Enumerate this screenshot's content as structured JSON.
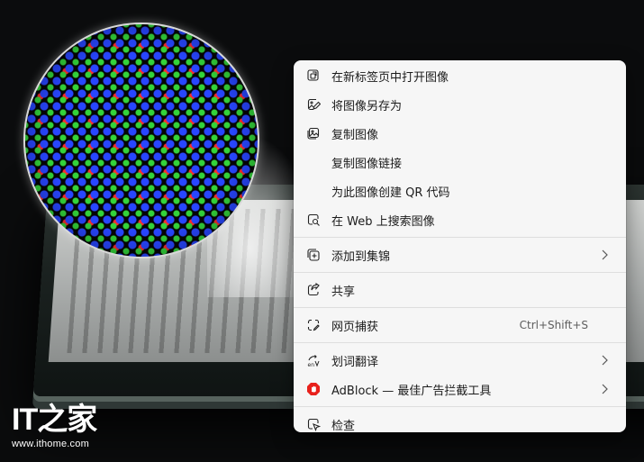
{
  "menu": {
    "items": {
      "open_new_tab": "在新标签页中打开图像",
      "save_as": "将图像另存为",
      "copy_image": "复制图像",
      "copy_link": "复制图像链接",
      "create_qr": "为此图像创建 QR 代码",
      "web_search": "在 Web 上搜索图像",
      "add_collection": "添加到集锦",
      "share": "共享",
      "web_capture": "网页捕获",
      "web_capture_shortcut": "Ctrl+Shift+S",
      "translate": "划词翻译",
      "adblock": "AdBlock — 最佳广告拦截工具",
      "inspect": "检查"
    }
  },
  "watermark": {
    "brand": "IT之家",
    "url": "www.ithome.com"
  },
  "colors": {
    "menu_bg": "#f6f6f6",
    "adblock_red": "#e8211c",
    "text": "#1b1b1b"
  },
  "icons": [
    "open-new-tab-icon",
    "save-image-icon",
    "copy-image-icon",
    "web-search-icon",
    "collection-icon",
    "share-icon",
    "web-capture-icon",
    "translate-icon",
    "adblock-icon",
    "inspect-icon",
    "chevron-right-icon"
  ]
}
